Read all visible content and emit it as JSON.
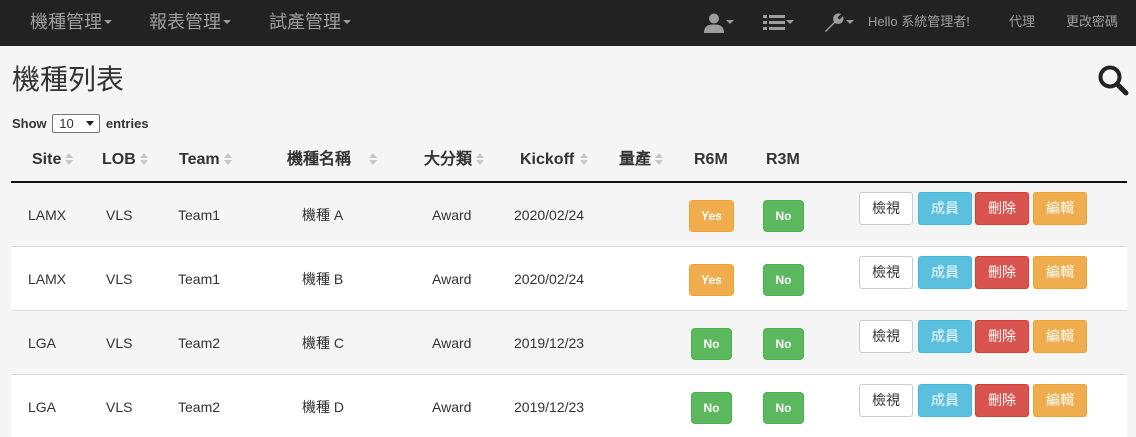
{
  "navbar": {
    "menus": [
      {
        "label": "機種管理"
      },
      {
        "label": "報表管理"
      },
      {
        "label": "試產管理"
      }
    ],
    "greeting": "Hello 系統管理者!",
    "proxy_link": "代理",
    "change_password_link": "更改密碼",
    "icons": [
      "user-icon",
      "list-icon",
      "wrench-icon"
    ]
  },
  "page": {
    "title": "機種列表"
  },
  "length_control": {
    "show_label": "Show",
    "value": "10",
    "entries_label": "entries"
  },
  "table": {
    "columns": [
      "Site",
      "LOB",
      "Team",
      "機種名稱",
      "大分類",
      "Kickoff",
      "量產",
      "R6M",
      "R3M"
    ],
    "rows": [
      {
        "site": "LAMX",
        "lob": "VLS",
        "team": "Team1",
        "name": "機種 A",
        "category": "Award",
        "kickoff": "2020/02/24",
        "mass": "",
        "r6m": "Yes",
        "r3m": "No"
      },
      {
        "site": "LAMX",
        "lob": "VLS",
        "team": "Team1",
        "name": "機種 B",
        "category": "Award",
        "kickoff": "2020/02/24",
        "mass": "",
        "r6m": "Yes",
        "r3m": "No"
      },
      {
        "site": "LGA",
        "lob": "VLS",
        "team": "Team2",
        "name": "機種 C",
        "category": "Award",
        "kickoff": "2019/12/23",
        "mass": "",
        "r6m": "No",
        "r3m": "No"
      },
      {
        "site": "LGA",
        "lob": "VLS",
        "team": "Team2",
        "name": "機種 D",
        "category": "Award",
        "kickoff": "2019/12/23",
        "mass": "",
        "r6m": "No",
        "r3m": "No"
      }
    ],
    "actions": {
      "view": "檢視",
      "member": "成員",
      "delete": "刪除",
      "edit": "編輯"
    }
  },
  "colors": {
    "navbar_bg": "#222222",
    "yes": "#f0ad4e",
    "no": "#5cb85c",
    "info": "#5bc0de",
    "danger": "#d9534f"
  }
}
